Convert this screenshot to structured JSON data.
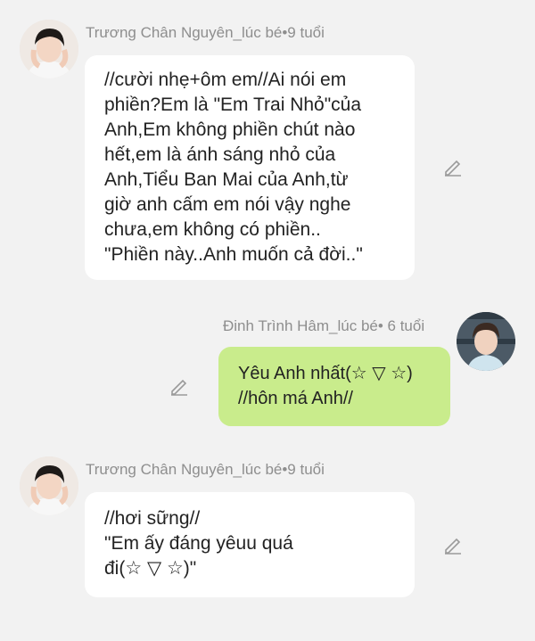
{
  "messages": [
    {
      "sender": "Trương Chân Nguyên_lúc bé•9 tuổi",
      "text": "//cười nhẹ+ôm em//Ai nói em\nphiền?Em là \"Em Trai Nhỏ\"của\nAnh,Em không phiền chút nào\nhết,em là ánh sáng nhỏ của\nAnh,Tiểu Ban Mai của Anh,từ\ngiờ anh cấm em nói vậy nghe\nchưa,em không có phiền..\n\"Phiền này..Anh muốn cả đời..\"",
      "side": "left"
    },
    {
      "sender": "Đinh Trình Hâm_lúc bé• 6 tuổi",
      "text": "Yêu Anh nhất(☆ ▽ ☆)\n//hôn má Anh//",
      "side": "right"
    },
    {
      "sender": "Trương Chân Nguyên_lúc bé•9 tuổi",
      "text": "//hơi sững//\n\"Em ấy đáng yêuu quá\nđi(☆ ▽ ☆)\"",
      "side": "left"
    }
  ],
  "colors": {
    "background": "#f2f2f2",
    "left_bubble": "#ffffff",
    "right_bubble": "#c9ec8c",
    "name_text": "#8e8e8e"
  },
  "icons": [
    "avatar-boy-icon",
    "edit-pencil-icon"
  ]
}
